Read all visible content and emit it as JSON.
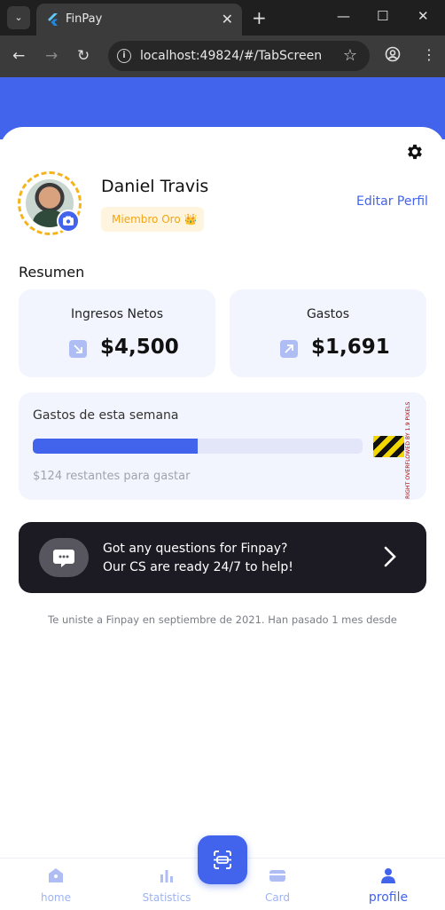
{
  "browser": {
    "tab_title": "FinPay",
    "url": "localhost:49824/#/TabScreen"
  },
  "profile": {
    "name": "Daniel Travis",
    "badge": "Miembro Oro 👑",
    "edit_label": "Editar Perfil"
  },
  "summary": {
    "title": "Resumen",
    "income_label": "Ingresos Netos",
    "income_value": "$4,500",
    "expense_label": "Gastos",
    "expense_value": "$1,691"
  },
  "weekly": {
    "title": "Gastos de esta semana",
    "progress_fraction": 0.5,
    "remaining": "$124 restantes para gastar",
    "overflow_warning": "RIGHT OVERFLOWED BY 1.9 PIXELS"
  },
  "support": {
    "line1": "Got any questions for Finpay?",
    "line2": "Our CS are ready 24/7 to help!"
  },
  "joined_text": "Te uniste a Finpay en septiembre de 2021. Han pasado 1 mes desde",
  "nav": {
    "home": "home",
    "statistics": "Statistics",
    "card": "Card",
    "profile": "profile"
  },
  "colors": {
    "brand": "#4263eb",
    "gold": "#f5b31c",
    "card_bg": "#f3f5fe",
    "dark_banner": "#1c1b24"
  }
}
